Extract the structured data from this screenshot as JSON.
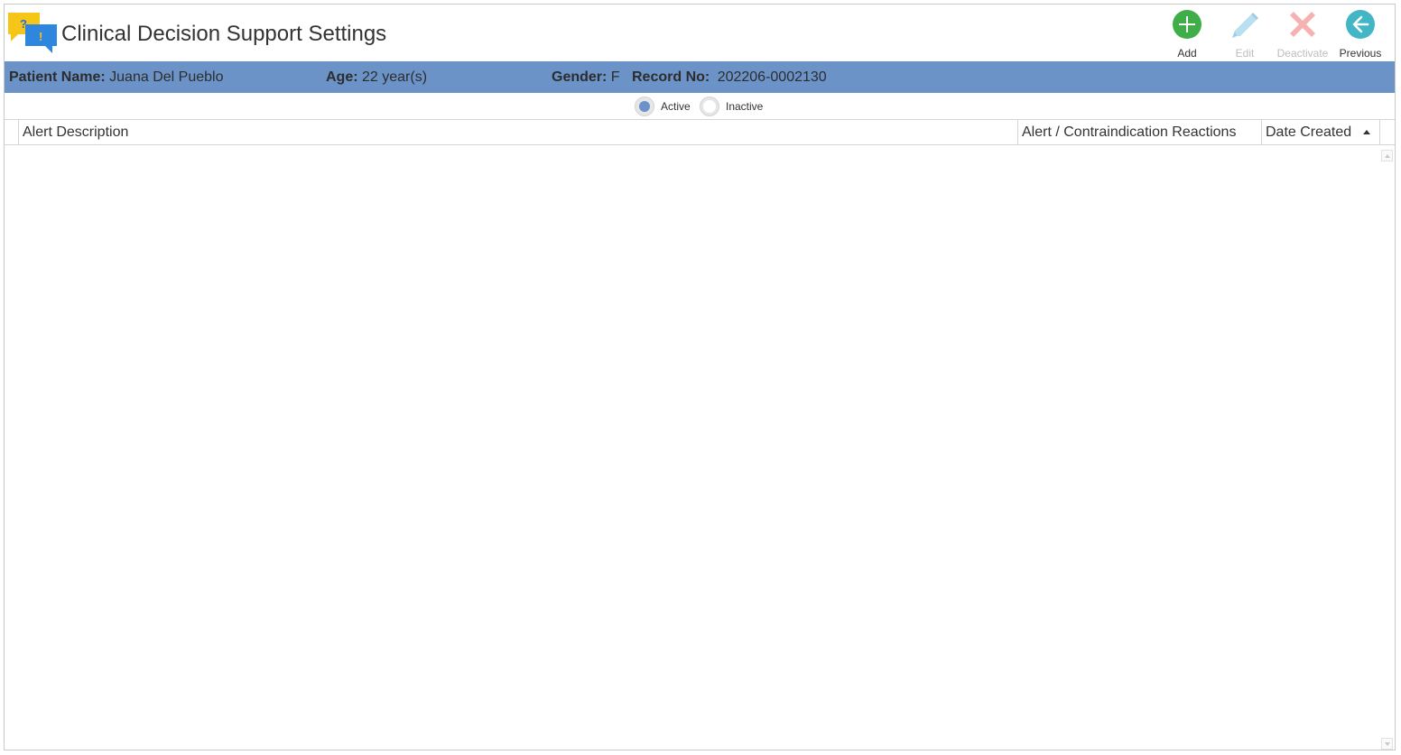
{
  "header": {
    "title": "Clinical Decision Support Settings",
    "app_icon": "chat-bubbles-question-exclamation-icon"
  },
  "toolbar": {
    "add": {
      "label": "Add",
      "icon": "plus-circle-icon",
      "color": "#3fae49",
      "enabled": true
    },
    "edit": {
      "label": "Edit",
      "icon": "pencil-icon",
      "color": "#a9d4ea",
      "enabled": false
    },
    "deactivate": {
      "label": "Deactivate",
      "icon": "x-icon",
      "color": "#f4a5a5",
      "enabled": false
    },
    "previous": {
      "label": "Previous",
      "icon": "arrow-left-circle-icon",
      "color": "#43b6c5",
      "enabled": true
    }
  },
  "patient": {
    "name_label": "Patient Name:",
    "name_value": "Juana Del Pueblo",
    "age_label": "Age:",
    "age_value": "22 year(s)",
    "gender_label": "Gender:",
    "gender_value": "F",
    "record_label": "Record No:",
    "record_value": "202206-0002130",
    "bar_color": "#6b93c8"
  },
  "status_filter": {
    "active_label": "Active",
    "inactive_label": "Inactive",
    "selected": "Active"
  },
  "grid": {
    "columns": [
      "Alert Description",
      "Alert / Contraindication Reactions",
      "Date Created"
    ],
    "sort_column": "Date Created",
    "sort_direction": "ascending",
    "rows": []
  }
}
